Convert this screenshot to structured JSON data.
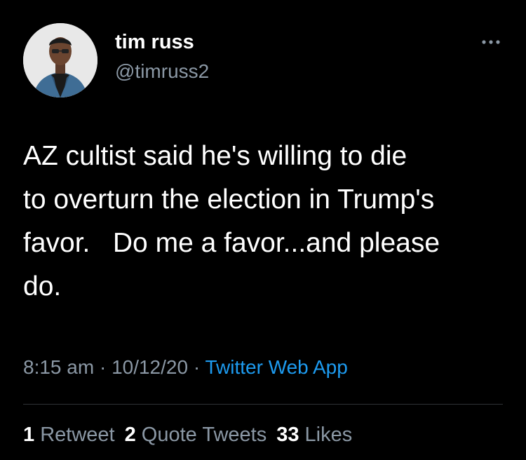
{
  "author": {
    "display_name": "tim russ",
    "handle": "@timruss2"
  },
  "tweet": {
    "text": "AZ cultist said he's willing to die\nto overturn the election in Trump's\nfavor.   Do me a favor...and please\ndo.",
    "time": "8:15 am",
    "date": "10/12/20",
    "source": "Twitter Web App",
    "separator": " · "
  },
  "stats": {
    "retweets_count": "1",
    "retweets_label": "Retweet",
    "quote_tweets_count": "2",
    "quote_tweets_label": "Quote Tweets",
    "likes_count": "33",
    "likes_label": "Likes"
  },
  "icons": {
    "more": "more-horizontal-icon",
    "avatar": "profile-photo"
  },
  "colors": {
    "background": "#000000",
    "text": "#ffffff",
    "muted": "#8b98a5",
    "link": "#1d9bf0",
    "divider": "#2f3336"
  }
}
